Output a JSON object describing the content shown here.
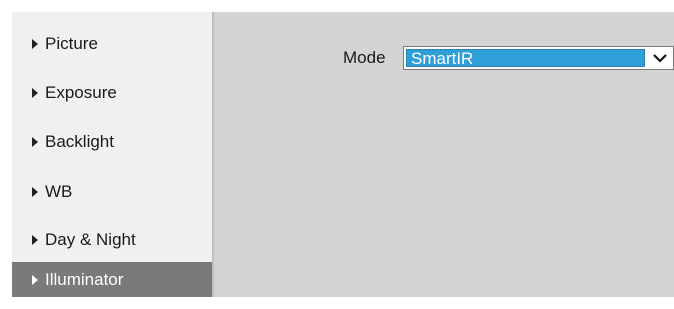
{
  "sidebar": {
    "items": [
      {
        "label": "Picture"
      },
      {
        "label": "Exposure"
      },
      {
        "label": "Backlight"
      },
      {
        "label": "WB"
      },
      {
        "label": "Day & Night"
      },
      {
        "label": "Illuminator"
      }
    ],
    "active_index": 5
  },
  "main": {
    "mode_label": "Mode",
    "mode_select": {
      "value": "SmartIR"
    }
  },
  "colors": {
    "sidebar_bg": "#f0f0f0",
    "active_item_bg": "#7a7a7a",
    "panel_bg": "#d4d4d4",
    "select_highlight": "#2f9fd8"
  },
  "icons": {
    "nav_arrow": "triangle-right-icon",
    "dropdown": "chevron-down-icon"
  }
}
